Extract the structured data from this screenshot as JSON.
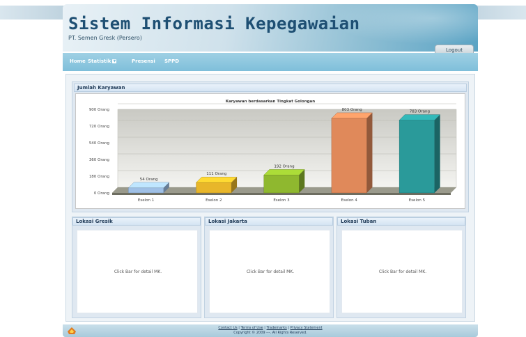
{
  "header": {
    "title": "Sistem Informasi Kepegawaian",
    "subtitle": "PT. Semen Gresk (Persero)",
    "logout_label": "Logout"
  },
  "nav": {
    "items": [
      {
        "label": "Home"
      },
      {
        "label": "Statistik"
      },
      {
        "label": "Presensi"
      },
      {
        "label": "SPPD"
      }
    ]
  },
  "chart_panel": {
    "heading": "Jumlah Karyawan"
  },
  "chart_data": {
    "type": "bar",
    "title": "Karyawan berdasarkan Tingkat Golongan",
    "categories": [
      "Eselon 1",
      "Eselon 2",
      "Eselon 3",
      "Eselon 4",
      "Eselon 5"
    ],
    "values": [
      54,
      111,
      192,
      803,
      783
    ],
    "value_labels": [
      "54 Orang",
      "111 Orang",
      "192 Orang",
      "803 Orang",
      "783 Orang"
    ],
    "ytick_labels": [
      "0 Orang",
      "180 Orang",
      "360 Orang",
      "540 Orang",
      "720 Orang",
      "900 Orang"
    ],
    "ylim": [
      0,
      900
    ],
    "bar_colors": [
      "#9fc0e6",
      "#e8b62a",
      "#8fb82f",
      "#e0895a",
      "#2a9a9a"
    ],
    "grid": true
  },
  "locations": [
    {
      "heading": "Lokasi Gresik",
      "message": "Click Bar for detail MK."
    },
    {
      "heading": "Lokasi Jakarta",
      "message": "Click Bar for detail MK."
    },
    {
      "heading": "Lokasi Tuban",
      "message": "Click Bar for detail MK."
    }
  ],
  "footer": {
    "links": [
      "Contact Us",
      "Terms of Use",
      "Trademarks",
      "Privacy Statement"
    ],
    "copyright": "Copyright © 2009 ---. All Rights Reserved."
  }
}
